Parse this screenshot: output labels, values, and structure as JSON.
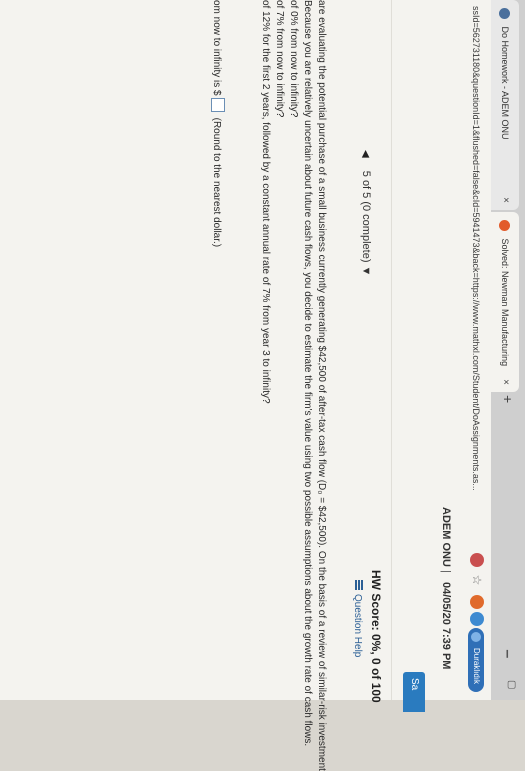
{
  "browser": {
    "tabs": [
      {
        "label": "Do Homework - ADEM ONU",
        "close": "×"
      },
      {
        "label": "Solved: Newman Manufacturing",
        "close": "×"
      }
    ],
    "new_tab": "+",
    "url": "ssId=562731180&questionId=1&flushed=false&cId=5941473&back=https://www.mathxl.com/Student/DoAssignments.as...",
    "profile_label": "Duraklıdık"
  },
  "page": {
    "user_name": "ADEM ONU",
    "separator": "|",
    "datetime": "04/05/20 7:39 PM",
    "save_label": "Sa",
    "nav": {
      "prev": "◀",
      "position": "5 of 5 (0 complete) ▼"
    },
    "hw_score": "HW Score: 0%, 0 of 100",
    "question_help": "Question Help",
    "problem_lines": [
      "are evaluating the potential purchase of a small business currently generating $42,500 of after-tax cash flow (D₀ = $42,500). On the basis of a review of similar-risk investment",
      "Because you are relatively uncertain about future cash flows, you decide to estimate the firm's value using two possible assumptions about the growth rate of cash flows.",
      "of 0% from now to infinity?",
      "of 7% from now to infinity?",
      "of 12% for the first 2 years, followed by a constant annual rate of 7% from year 3 to infinity?"
    ],
    "answer_prefix": "om now to infinity is $",
    "answer_hint": "(Round to the nearest dollar.)"
  },
  "colors": {
    "accent": "#2a7bbf",
    "link": "#2b5f95"
  }
}
